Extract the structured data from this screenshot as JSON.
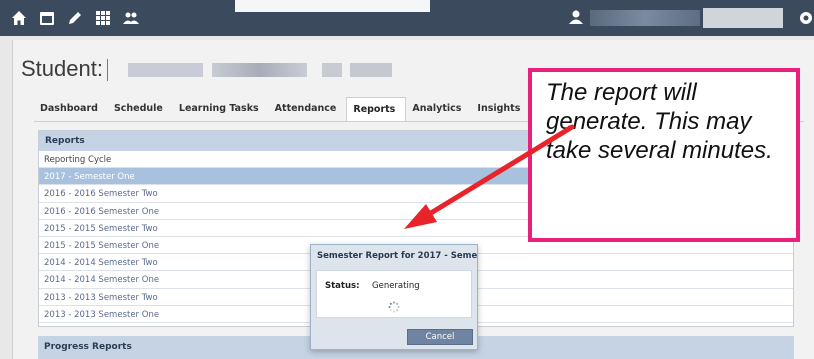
{
  "navbar": {
    "icons": [
      "home-icon",
      "calendar-icon",
      "pencil-icon",
      "grid-icon",
      "people-icon"
    ],
    "right_icons": [
      "user-icon",
      "settings-icon"
    ]
  },
  "student": {
    "label": "Student:"
  },
  "tabs": [
    {
      "label": "Dashboard",
      "active": false
    },
    {
      "label": "Schedule",
      "active": false
    },
    {
      "label": "Learning Tasks",
      "active": false
    },
    {
      "label": "Attendance",
      "active": false
    },
    {
      "label": "Reports",
      "active": true
    },
    {
      "label": "Analytics",
      "active": false
    },
    {
      "label": "Insights",
      "active": false
    }
  ],
  "reports": {
    "title": "Reports",
    "column_header": "Reporting Cycle",
    "rows": [
      "2017 - Semester One",
      "2016 - 2016 Semester Two",
      "2016 - 2016 Semester One",
      "2015 - 2015 Semester Two",
      "2015 - 2015 Semester One",
      "2014 - 2014 Semester Two",
      "2014 - 2014 Semester One",
      "2013 - 2013 Semester Two",
      "2013 - 2013 Semester One"
    ],
    "selected_index": 0
  },
  "progress_reports": {
    "title": "Progress Reports"
  },
  "modal": {
    "title": "Semester Report for 2017 - Seme...",
    "status_label": "Status:",
    "status_value": "Generating",
    "cancel_label": "Cancel"
  },
  "callout": {
    "text": "The report will generate. This may take several minutes.",
    "border_color": "#e8217c",
    "arrow_color": "#e8232a"
  },
  "colors": {
    "navbar": "#3b4a5c",
    "panel_header": "#c5d3e4",
    "selected_row": "#a8c1de",
    "cancel_button": "#6f84a0"
  }
}
